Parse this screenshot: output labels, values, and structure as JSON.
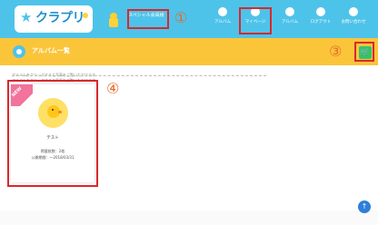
{
  "header": {
    "logo_text": "クラプリ",
    "logo_star": "★",
    "user_label": "スペシャル会員様",
    "nav": [
      {
        "label": "アルバム",
        "icon": "album-icon"
      },
      {
        "label": "マイページ",
        "icon": "person-icon"
      },
      {
        "label": "アルバム",
        "icon": "photo-icon"
      },
      {
        "label": "ログアウト",
        "icon": "logout-icon"
      },
      {
        "label": "お問い合わせ",
        "icon": "help-icon"
      }
    ]
  },
  "subbar": {
    "title": "アルバム一覧",
    "cart_icon": "🛒"
  },
  "annotations": {
    "n1": "①",
    "n2": "②",
    "n3": "③",
    "n4": "④"
  },
  "notice": {
    "line1": "アルバムをクリックすると写真をご覧いただけます",
    "line2": "アルバムをクリックすると写真をご覧いただけます"
  },
  "album": {
    "badge": "NEW",
    "name": "テスト",
    "meta1": "掲載枚数：2枚",
    "meta2": "公開期間：～2018/03/31"
  },
  "scroll_top": "↑",
  "colors": {
    "header_bg": "#4ec3ea",
    "subbar_bg": "#fbc53a",
    "annotation_red": "#d8282e",
    "annotation_number": "#e56a2a",
    "cart_green": "#36c46a",
    "new_badge": "#f2739b"
  }
}
